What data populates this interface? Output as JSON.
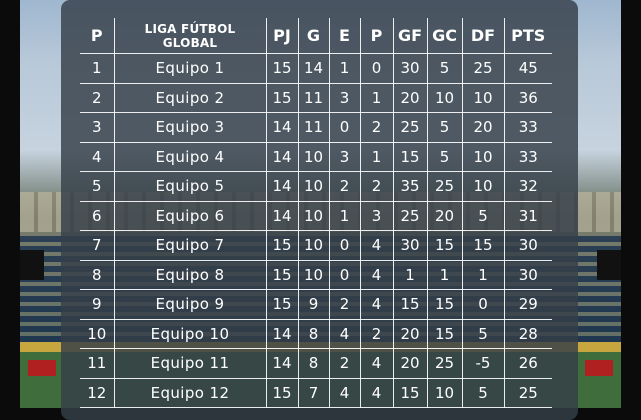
{
  "header": {
    "pos": "P",
    "league_line1": "LIGA FÚTBOL",
    "league_line2": "GLOBAL",
    "pj": "PJ",
    "g": "G",
    "e": "E",
    "p": "P",
    "gf": "GF",
    "gc": "GC",
    "df": "DF",
    "pts": "PTS"
  },
  "rows": [
    {
      "pos": "1",
      "team": "Equipo 1",
      "pj": "15",
      "g": "14",
      "e": "1",
      "p": "0",
      "gf": "30",
      "gc": "5",
      "df": "25",
      "pts": "45"
    },
    {
      "pos": "2",
      "team": "Equipo 2",
      "pj": "15",
      "g": "11",
      "e": "3",
      "p": "1",
      "gf": "20",
      "gc": "10",
      "df": "10",
      "pts": "36"
    },
    {
      "pos": "3",
      "team": "Equipo 3",
      "pj": "14",
      "g": "11",
      "e": "0",
      "p": "2",
      "gf": "25",
      "gc": "5",
      "df": "20",
      "pts": "33"
    },
    {
      "pos": "4",
      "team": "Equipo 4",
      "pj": "14",
      "g": "10",
      "e": "3",
      "p": "1",
      "gf": "15",
      "gc": "5",
      "df": "10",
      "pts": "33"
    },
    {
      "pos": "5",
      "team": "Equipo 5",
      "pj": "14",
      "g": "10",
      "e": "2",
      "p": "2",
      "gf": "35",
      "gc": "25",
      "df": "10",
      "pts": "32"
    },
    {
      "pos": "6",
      "team": "Equipo 6",
      "pj": "14",
      "g": "10",
      "e": "1",
      "p": "3",
      "gf": "25",
      "gc": "20",
      "df": "5",
      "pts": "31"
    },
    {
      "pos": "7",
      "team": "Equipo 7",
      "pj": "15",
      "g": "10",
      "e": "0",
      "p": "4",
      "gf": "30",
      "gc": "15",
      "df": "15",
      "pts": "30"
    },
    {
      "pos": "8",
      "team": "Equipo 8",
      "pj": "15",
      "g": "10",
      "e": "0",
      "p": "4",
      "gf": "1",
      "gc": "1",
      "df": "1",
      "pts": "30"
    },
    {
      "pos": "9",
      "team": "Equipo 9",
      "pj": "15",
      "g": "9",
      "e": "2",
      "p": "4",
      "gf": "15",
      "gc": "15",
      "df": "0",
      "pts": "29"
    },
    {
      "pos": "10",
      "team": "Equipo 10",
      "pj": "14",
      "g": "8",
      "e": "4",
      "p": "2",
      "gf": "20",
      "gc": "15",
      "df": "5",
      "pts": "28"
    },
    {
      "pos": "11",
      "team": "Equipo 11",
      "pj": "14",
      "g": "8",
      "e": "2",
      "p": "4",
      "gf": "20",
      "gc": "25",
      "df": "-5",
      "pts": "26"
    },
    {
      "pos": "12",
      "team": "Equipo 12",
      "pj": "15",
      "g": "7",
      "e": "4",
      "p": "4",
      "gf": "15",
      "gc": "10",
      "df": "5",
      "pts": "25"
    }
  ]
}
